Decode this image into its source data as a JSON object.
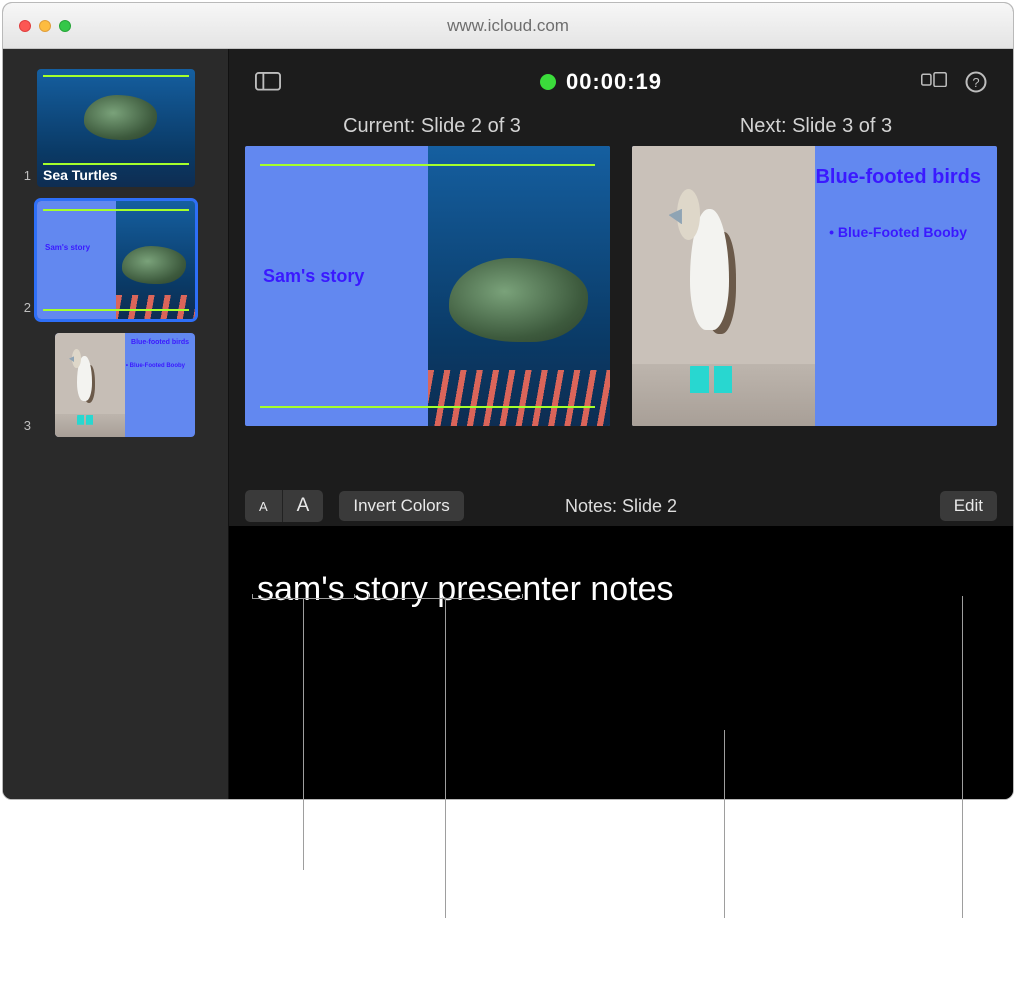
{
  "window": {
    "url": "www.icloud.com"
  },
  "timer": "00:00:19",
  "sidebar": {
    "items": [
      {
        "num": "1",
        "title": "Sea Turtles"
      },
      {
        "num": "2",
        "title": "Sam's story"
      },
      {
        "num": "3",
        "title": "Blue-footed birds",
        "bullet": "Blue-Footed Booby"
      }
    ]
  },
  "labels": {
    "current": "Current: Slide 2 of 3",
    "next": "Next: Slide 3 of 3"
  },
  "preview": {
    "current": {
      "title": "Sam's story"
    },
    "next": {
      "title": "Blue-footed birds",
      "bullet": "Blue-Footed Booby"
    }
  },
  "notesbar": {
    "small_a": "A",
    "big_a": "A",
    "invert": "Invert Colors",
    "title": "Notes: Slide 2",
    "edit": "Edit"
  },
  "notes_body": "sam's story presenter notes"
}
